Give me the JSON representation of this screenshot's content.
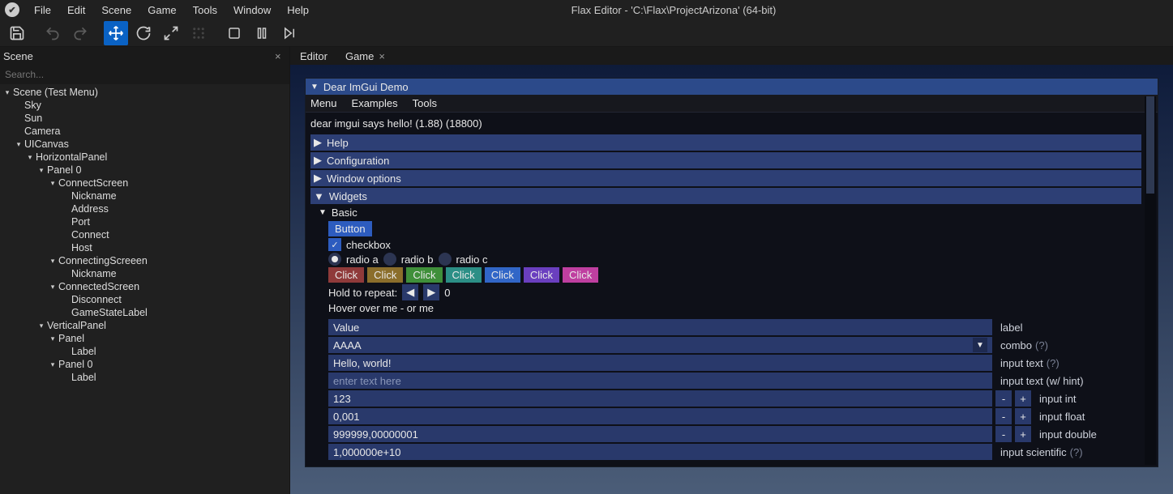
{
  "app": {
    "title": "Flax Editor - 'C:\\Flax\\ProjectArizona' (64-bit)"
  },
  "menu": {
    "file": "File",
    "edit": "Edit",
    "scene": "Scene",
    "game": "Game",
    "tools": "Tools",
    "window": "Window",
    "help": "Help"
  },
  "leftPanel": {
    "title": "Scene",
    "search_placeholder": "Search...",
    "tree": {
      "root": "Scene (Test Menu)",
      "sky": "Sky",
      "sun": "Sun",
      "camera": "Camera",
      "uicanvas": "UICanvas",
      "hpanel": "HorizontalPanel",
      "panel0a": "Panel 0",
      "connectscreen": "ConnectScreen",
      "nickname": "Nickname",
      "address": "Address",
      "port": "Port",
      "connect": "Connect",
      "host": "Host",
      "connectingscreen": "ConnectingScreeen",
      "nickname2": "Nickname",
      "connectedscreen": "ConnectedScreen",
      "disconnect": "Disconnect",
      "gamestatelabel": "GameStateLabel",
      "vpanel": "VerticalPanel",
      "panel": "Panel",
      "label": "Label",
      "panel0b": "Panel 0",
      "label2": "Label"
    }
  },
  "rightPanel": {
    "tabs": {
      "editor": "Editor",
      "game": "Game"
    }
  },
  "imgui": {
    "title": "Dear ImGui Demo",
    "menu": {
      "a": "Menu",
      "b": "Examples",
      "c": "Tools"
    },
    "hello": "dear imgui says hello! (1.88) (18800)",
    "headers": {
      "help": "Help",
      "config": "Configuration",
      "winopt": "Window options",
      "widgets": "Widgets"
    },
    "basic": "Basic",
    "button": "Button",
    "checkbox": "checkbox",
    "radios": {
      "a": "radio a",
      "b": "radio b",
      "c": "radio c"
    },
    "click": "Click",
    "holdrepeat": "Hold to repeat:",
    "repeat_value": "0",
    "hover": "Hover over me - or me",
    "labelrow": {
      "left": "Value",
      "right": "label"
    },
    "combo_val": "AAAA",
    "combolabel": "combo",
    "hint": "(?)",
    "input_text_val": "Hello, world!",
    "input_text_label": "input text",
    "input_hint_placeholder": "enter text here",
    "input_hint_label": "input text (w/ hint)",
    "input_int_val": "123",
    "input_int_label": "input int",
    "input_float_val": "0,001",
    "input_float_label": "input float",
    "input_double_val": "999999,00000001",
    "input_double_label": "input double",
    "input_sci_val": "1,000000e+10",
    "input_sci_label": "input scientific",
    "colors": {
      "click1": "#8f3a3a",
      "click2": "#8b6e2b",
      "click3": "#3f8f3a",
      "click4": "#2c8f86",
      "click5": "#3166c7",
      "click6": "#6a3fbf",
      "click7": "#bf3fa0"
    }
  }
}
